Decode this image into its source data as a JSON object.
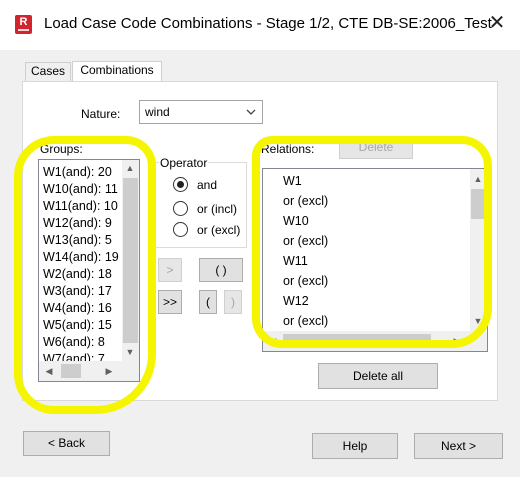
{
  "window": {
    "title": "Load Case Code Combinations - Stage 1/2, CTE DB-SE:2006_Test",
    "app_icon_text": "R"
  },
  "tabs": [
    {
      "label": "Cases",
      "active": false
    },
    {
      "label": "Combinations",
      "active": true
    }
  ],
  "nature": {
    "label": "Nature:",
    "value": "wind"
  },
  "groups": {
    "label": "Groups:",
    "items": [
      "W1(and): 20",
      "W10(and): 11",
      "W11(and): 10",
      "W12(and): 9",
      "W13(and): 5",
      "W14(and): 19",
      "W2(and): 18",
      "W3(and): 17",
      "W4(and): 16",
      "W5(and): 15",
      "W6(and): 8",
      "W7(and): 7"
    ]
  },
  "operator": {
    "label": "Operator",
    "options": [
      {
        "label": "and",
        "checked": true
      },
      {
        "label": "or (incl)",
        "checked": false
      },
      {
        "label": "or (excl)",
        "checked": false
      }
    ]
  },
  "move_buttons": {
    "add_one": ">",
    "add_all": ">>",
    "parens": "( )",
    "open_paren": "(",
    "close_paren": ")"
  },
  "relations": {
    "label": "Relations:",
    "delete_label": "Delete",
    "delete_all_label": "Delete all",
    "items": [
      "W1",
      "or (excl)",
      "W10",
      "or (excl)",
      "W11",
      "or (excl)",
      "W12",
      "or (excl)"
    ]
  },
  "footer": {
    "back": "< Back",
    "help": "Help",
    "next": "Next >"
  },
  "highlight_color": "#f6f500"
}
